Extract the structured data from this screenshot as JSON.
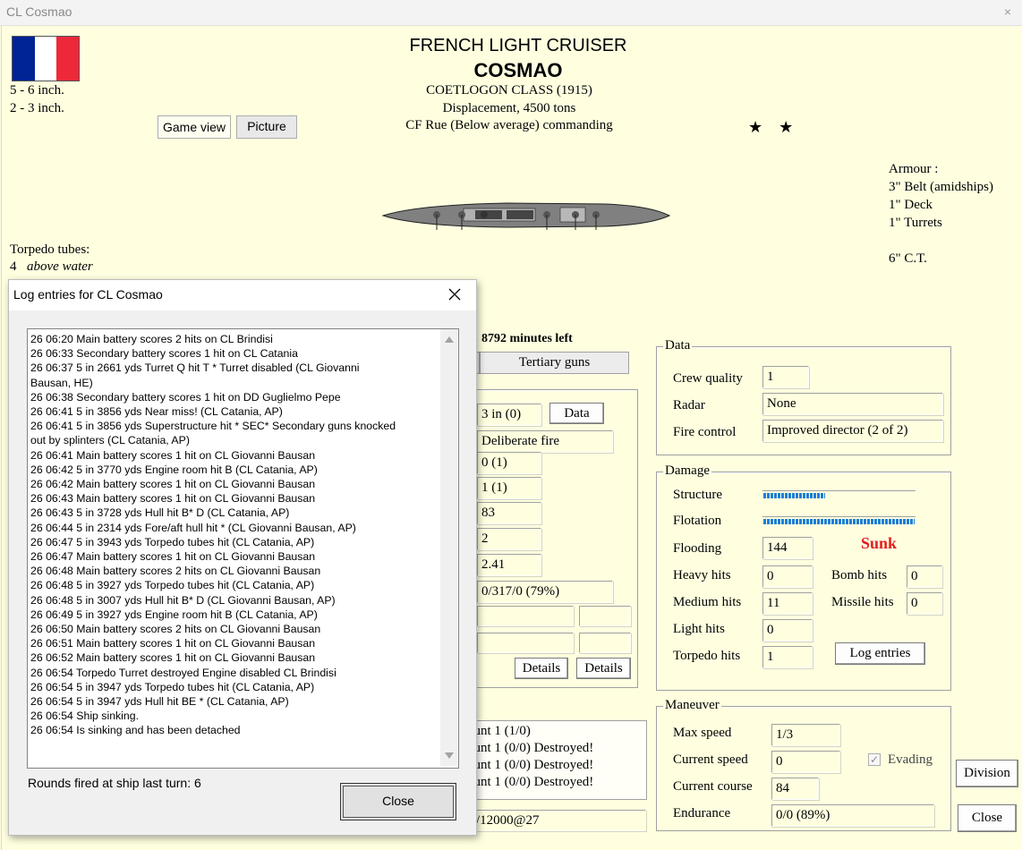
{
  "window": {
    "title": "CL Cosmao",
    "close_glyph": "×"
  },
  "header": {
    "line1": "FRENCH LIGHT CRUISER",
    "ship_name": "COSMAO",
    "class_line": "COETLOGON CLASS (1915)",
    "displacement": "Displacement, 4500 tons",
    "commander": "CF Rue (Below average)  commanding",
    "stars": "★    ★"
  },
  "flag": {
    "colors": [
      "#002395",
      "#ffffff",
      "#ed2939"
    ]
  },
  "guns": [
    "5 - 6 inch.",
    "2 - 3 inch."
  ],
  "view_tabs": [
    "Game view",
    "Picture"
  ],
  "armour": {
    "title": "Armour :",
    "lines": [
      "3\" Belt (amidships)",
      "1\" Deck",
      "1\" Turrets",
      "",
      "6\" C.T."
    ]
  },
  "torpedo_tubes": {
    "title": "Torpedo tubes:",
    "count": "4",
    "position": "above water"
  },
  "time_left": "n! 8792 minutes left",
  "gun_tabs": {
    "tertiary": "Tertiary guns"
  },
  "gun_panel": {
    "cal": "3 in (0)",
    "data_button": "Data",
    "fire_mode": "Deliberate fire",
    "v1": "0 (1)",
    "v2": "1 (1)",
    "v3": "83",
    "v4": "2",
    "v5": "2.41",
    "ammo": "0/317/0 (79%)",
    "details1": "Details",
    "details2": "Details"
  },
  "mounts": [
    "ount 1 (1/0)",
    "ount 1 (0/0) Destroyed!",
    "ount 1 (0/0) Destroyed!",
    "ount 1 (0/0) Destroyed!"
  ],
  "bottom_field": "/12000@27",
  "data_group": {
    "title": "Data",
    "crew_quality_label": "Crew quality",
    "crew_quality": "1",
    "radar_label": "Radar",
    "radar": "None",
    "fire_control_label": "Fire control",
    "fire_control": "Improved director (2 of 2)"
  },
  "damage_group": {
    "title": "Damage",
    "structure_label": "Structure",
    "structure_fraction": 0.41,
    "flotation_label": "Flotation",
    "flotation_fraction": 1.0,
    "flooding_label": "Flooding",
    "flooding": "144",
    "status": "Sunk",
    "heavy_hits_label": "Heavy hits",
    "heavy_hits": "0",
    "bomb_hits_label": "Bomb hits",
    "bomb_hits": "0",
    "medium_hits_label": "Medium hits",
    "medium_hits": "11",
    "missile_hits_label": "Missile hits",
    "missile_hits": "0",
    "light_hits_label": "Light hits",
    "light_hits": "0",
    "torpedo_hits_label": "Torpedo hits",
    "torpedo_hits": "1",
    "log_button": "Log entries"
  },
  "maneuver_group": {
    "title": "Maneuver",
    "max_speed_label": "Max speed",
    "max_speed": "1/3",
    "current_speed_label": "Current speed",
    "current_speed": "0",
    "evading_label": "Evading",
    "evading_checked": true,
    "current_course_label": "Current course",
    "current_course": "84",
    "endurance_label": "Endurance",
    "endurance": "0/0 (89%)"
  },
  "side_buttons": {
    "division": "Division",
    "close": "Close"
  },
  "log_dialog": {
    "title": "Log entries for CL Cosmao",
    "entries": [
      "26 06:20   Main battery scores 2 hits on CL Brindisi",
      "26 06:33   Secondary battery scores 1 hit on CL Catania",
      "26 06:37  5 in 2661 yds Turret Q hit T * Turret disabled (CL Giovanni",
      "Bausan, HE)",
      "26 06:38   Secondary battery scores 1 hit on DD Guglielmo Pepe",
      "26 06:41  5 in 3856 yds Near miss! (CL Catania, AP)",
      "26 06:41  5 in 3856 yds Superstructure hit *  SEC* Secondary guns knocked",
      "out by splinters (CL Catania, AP)",
      "26 06:41   Main battery scores 1 hit on CL Giovanni Bausan",
      "26 06:42  5 in 3770 yds Engine room hit B (CL Catania, AP)",
      "26 06:42   Main battery scores 1 hit on CL Giovanni Bausan",
      "26 06:43   Main battery scores 1 hit on CL Giovanni Bausan",
      "26 06:43  5 in 3728 yds Hull hit B* D (CL Catania, AP)",
      "26 06:44  5 in 2314 yds Fore/aft hull hit * (CL Giovanni Bausan, AP)",
      "26 06:47  5 in 3943 yds Torpedo tubes hit (CL Catania, AP)",
      "26 06:47   Main battery scores 1 hit on CL Giovanni Bausan",
      "26 06:48   Main battery scores 2 hits on CL Giovanni Bausan",
      "26 06:48  5 in 3927 yds Torpedo tubes hit (CL Catania, AP)",
      "26 06:48  5 in 3007 yds Hull hit B* D (CL Giovanni Bausan, AP)",
      "26 06:49  5 in 3927 yds Engine room hit B (CL Catania, AP)",
      "26 06:50   Main battery scores 2 hits on CL Giovanni Bausan",
      "26 06:51   Main battery scores 1 hit on CL Giovanni Bausan",
      "26 06:52   Main battery scores 1 hit on CL Giovanni Bausan",
      "26 06:54  Torpedo Turret destroyed Engine disabled CL Brindisi",
      "26 06:54  5 in 3947 yds Torpedo tubes hit (CL Catania, AP)",
      "26 06:54  5 in 3947 yds Hull hit BE * (CL Catania, AP)",
      "26 06:54 Ship sinking.",
      "26 06:54 Is sinking and has been detached"
    ],
    "rounds_fired": "Rounds fired at ship last turn: 6",
    "close_button": "Close"
  }
}
